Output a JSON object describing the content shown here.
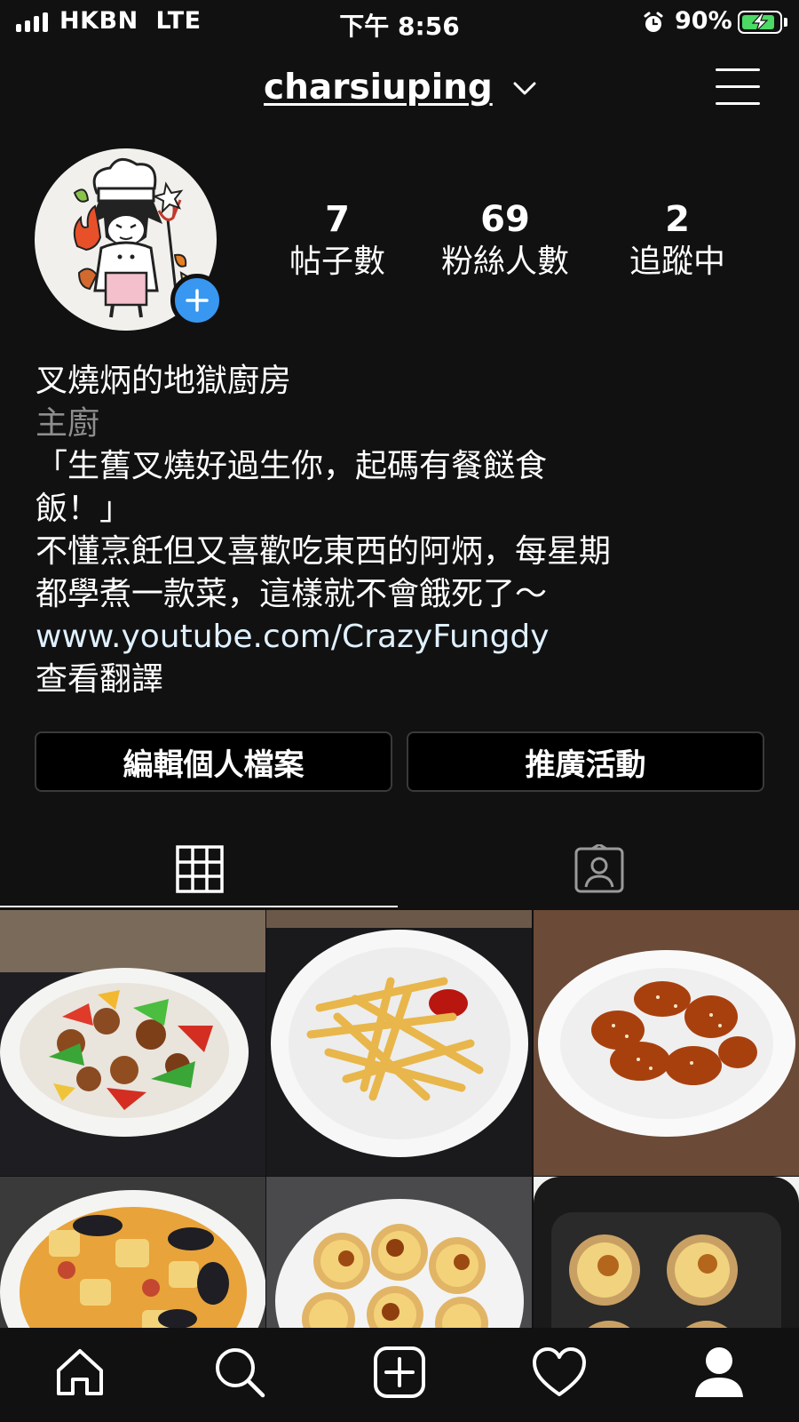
{
  "status_bar": {
    "carrier": "HKBN  LTE",
    "time": "下午 8:56",
    "battery_percent": "90%",
    "battery_level": 0.9,
    "alarm_icon": "alarm-clock-icon"
  },
  "header": {
    "username": "charsiuping",
    "dropdown_icon": "chevron-down-icon",
    "menu_icon": "hamburger-menu-icon"
  },
  "profile": {
    "stats": [
      {
        "value": "7",
        "label": "帖子數"
      },
      {
        "value": "69",
        "label": "粉絲人數"
      },
      {
        "value": "2",
        "label": "追蹤中"
      }
    ],
    "name": "叉燒炳的地獄廚房",
    "category": "主廚",
    "bio_lines": [
      "「生舊叉燒好過生你，起碼有餐餸食",
      "飯！」",
      "不懂烹飪但又喜歡吃東西的阿炳，每星期",
      "都學煮一款菜，這樣就不會餓死了～"
    ],
    "website": "www.youtube.com/CrazyFungdy",
    "translate": "查看翻譯"
  },
  "actions": {
    "edit_profile": "編輯個人檔案",
    "promotions": "推廣活動"
  },
  "tabs": {
    "grid_icon": "grid-icon",
    "tagged_icon": "tagged-person-icon"
  },
  "posts": [
    {
      "name": "sweet-and-sour-pork-photo"
    },
    {
      "name": "french-fries-photo"
    },
    {
      "name": "sesame-chicken-wings-photo"
    },
    {
      "name": "seafood-curry-photo"
    },
    {
      "name": "egg-tarts-photo"
    },
    {
      "name": "air-fryer-egg-tarts-photo"
    }
  ],
  "bottom_nav": [
    "home-icon",
    "search-icon",
    "new-post-icon",
    "heart-icon",
    "profile-icon"
  ],
  "colors": {
    "background": "#111112",
    "accent_blue": "#3897f0",
    "link": "#e0f1ff",
    "battery_green": "#4cd964",
    "secondary_text": "#8e8e8e"
  }
}
